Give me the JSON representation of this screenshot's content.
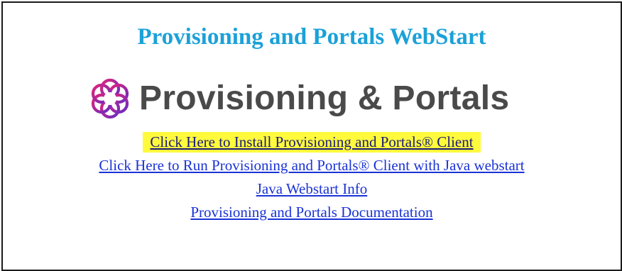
{
  "page": {
    "title": "Provisioning and Portals WebStart"
  },
  "logo": {
    "icon": "interlocking-rings-logo-icon",
    "text": "Provisioning & Portals",
    "colors": {
      "ring_start": "#e0237a",
      "ring_end": "#6a2cc4",
      "text": "#4a4a4a"
    }
  },
  "links": [
    {
      "label": "Click Here to Install Provisioning and Portals® Client",
      "highlighted": true
    },
    {
      "label": "Click Here to Run Provisioning and Portals® Client with Java webstart",
      "highlighted": false
    },
    {
      "label": "Java Webstart Info",
      "highlighted": false
    },
    {
      "label": "Provisioning and Portals Documentation",
      "highlighted": false
    }
  ],
  "colors": {
    "title": "#1ba1d8",
    "link": "#1a33d6",
    "highlight": "#fffa3c"
  }
}
